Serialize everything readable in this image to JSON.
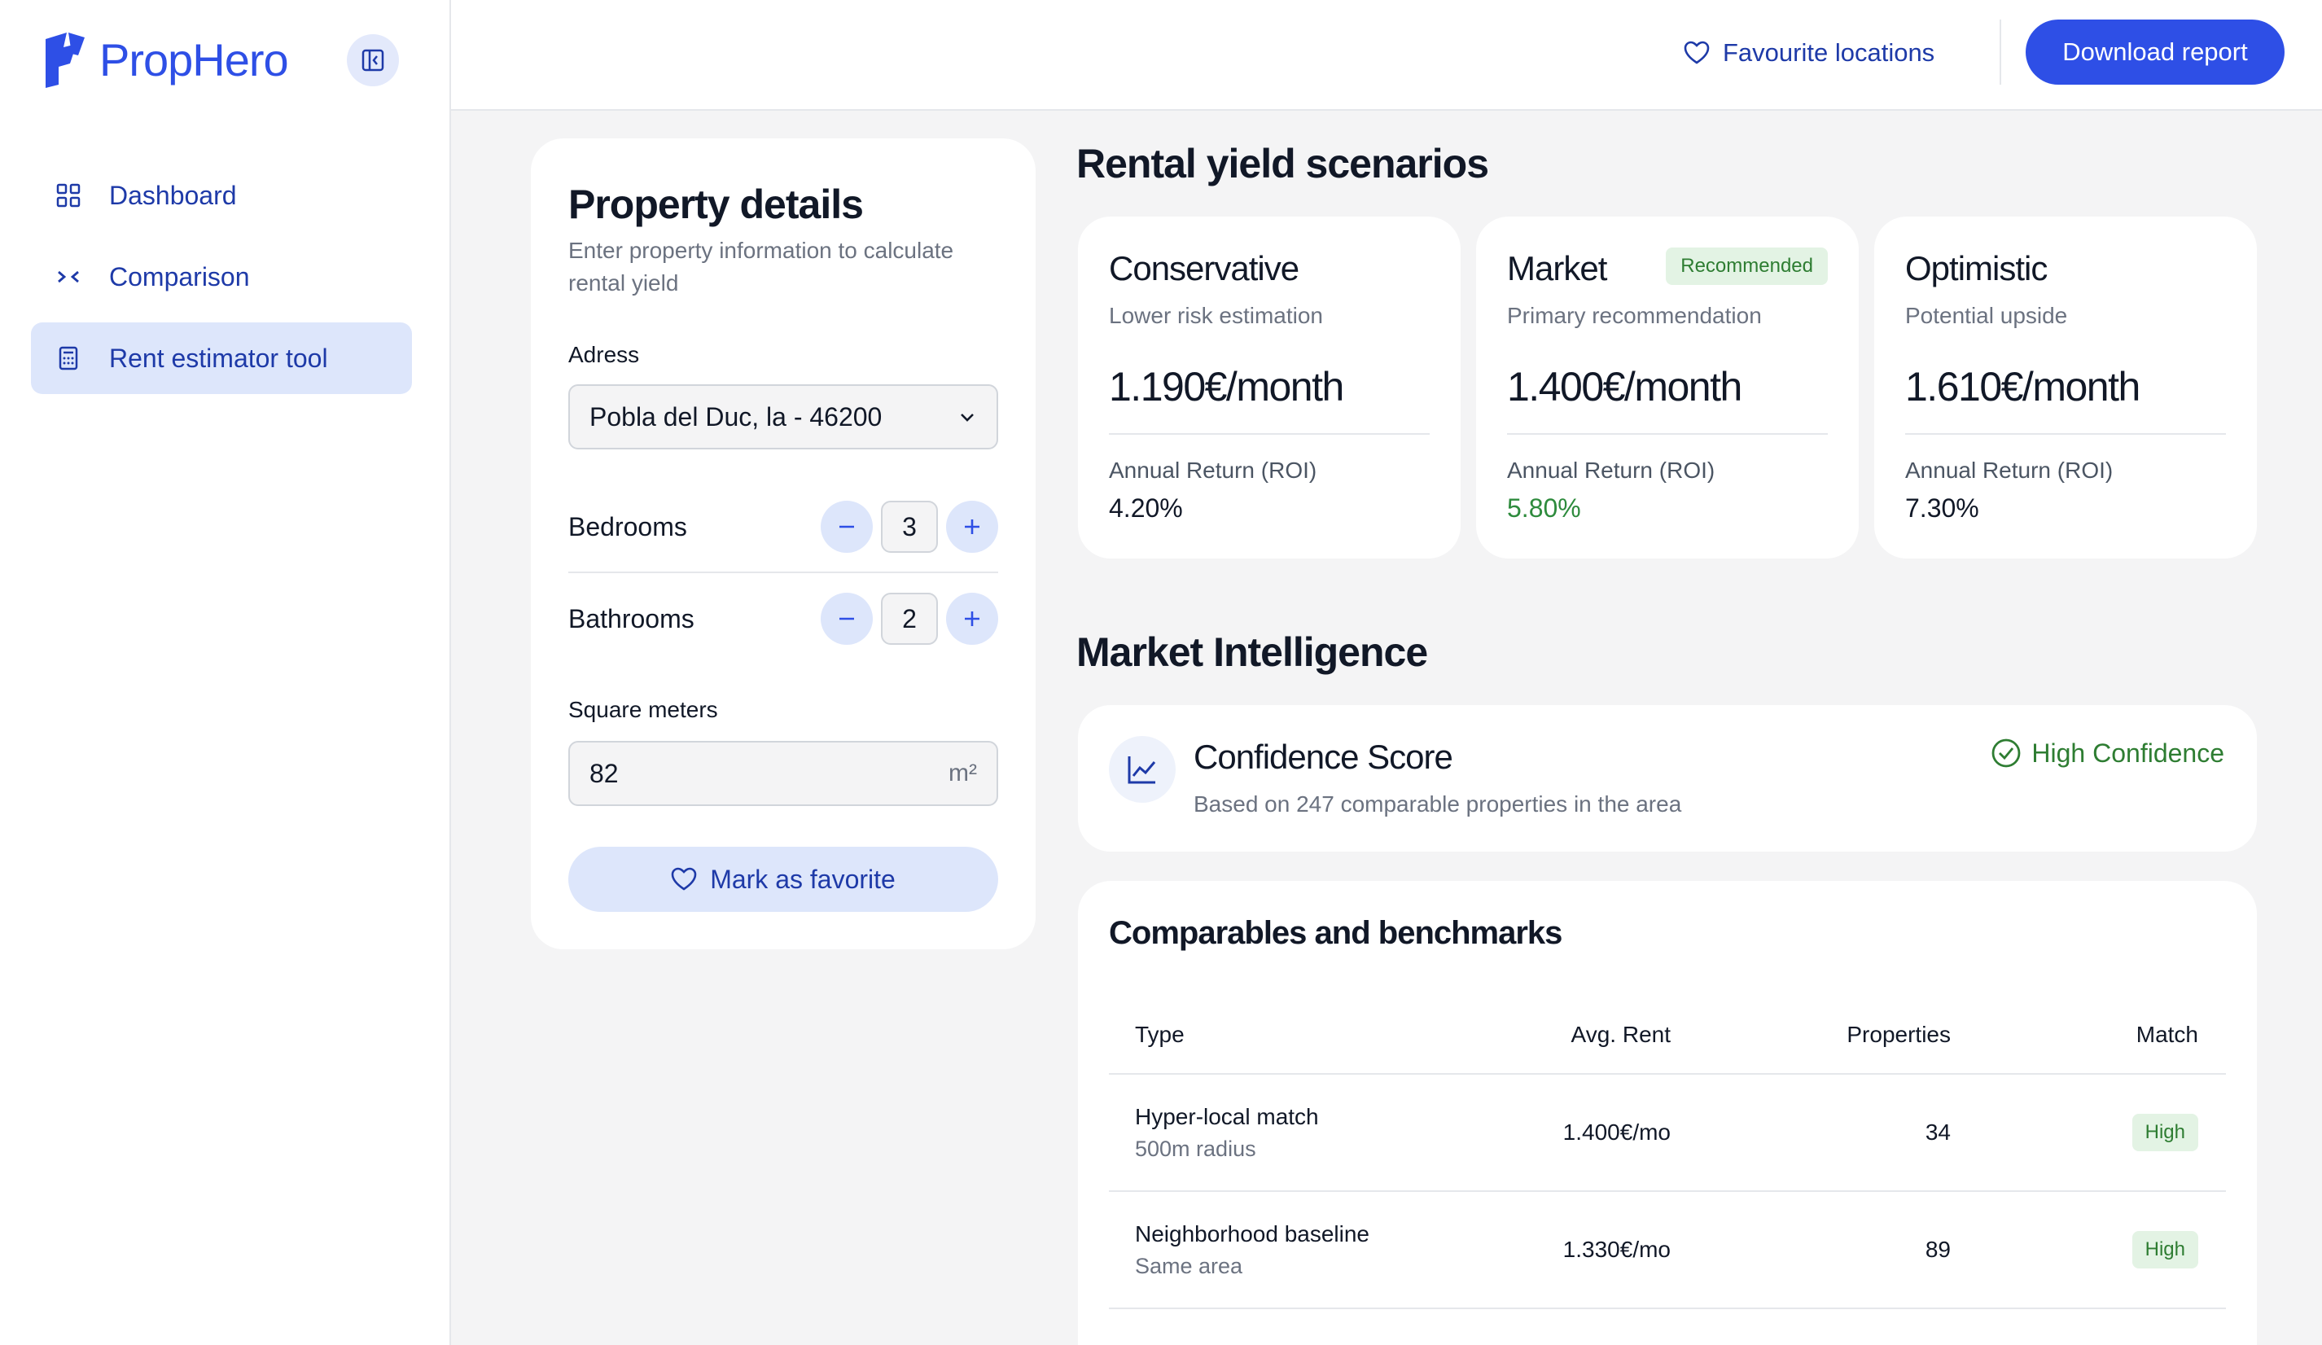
{
  "brand": {
    "name": "PropHero"
  },
  "sidebar": {
    "items": [
      {
        "label": "Dashboard",
        "icon": "grid-icon"
      },
      {
        "label": "Comparison",
        "icon": "compare-icon"
      },
      {
        "label": "Rent estimator tool",
        "icon": "calculator-icon",
        "active": true
      }
    ]
  },
  "topbar": {
    "favourite_label": "Favourite locations",
    "download_label": "Download report"
  },
  "property": {
    "title": "Property details",
    "subtitle": "Enter property information to calculate rental yield",
    "address_label": "Adress",
    "address_value": "Pobla del Duc, la - 46200",
    "bedrooms_label": "Bedrooms",
    "bedrooms_value": "3",
    "bathrooms_label": "Bathrooms",
    "bathrooms_value": "2",
    "sqm_label": "Square meters",
    "sqm_value": "82",
    "sqm_unit": "m²",
    "favorite_label": "Mark as favorite"
  },
  "scenarios": {
    "title": "Rental yield scenarios",
    "items": [
      {
        "name": "Conservative",
        "subtitle": "Lower risk estimation",
        "value": "1.190€/month",
        "roi_label": "Annual Return (ROI)",
        "roi": "4.20%"
      },
      {
        "name": "Market",
        "badge": "Recommended",
        "subtitle": "Primary recommendation",
        "value": "1.400€/month",
        "roi_label": "Annual Return (ROI)",
        "roi": "5.80%"
      },
      {
        "name": "Optimistic",
        "subtitle": "Potential upside",
        "value": "1.610€/month",
        "roi_label": "Annual Return (ROI)",
        "roi": "7.30%"
      }
    ]
  },
  "market": {
    "title": "Market Intelligence",
    "confidence_title": "Confidence Score",
    "confidence_sub": "Based on 247 comparable properties in the area",
    "confidence_status": "High Confidence"
  },
  "comparables": {
    "title": "Comparables and benchmarks",
    "headers": {
      "type": "Type",
      "rent": "Avg. Rent",
      "props": "Properties",
      "match": "Match"
    },
    "rows": [
      {
        "type": "Hyper-local match",
        "sub": "500m radius",
        "rent": "1.400€/mo",
        "props": "34",
        "match": "High"
      },
      {
        "type": "Neighborhood baseline",
        "sub": "Same area",
        "rent": "1.330€/mo",
        "props": "89",
        "match": "High"
      }
    ]
  },
  "colors": {
    "primary": "#2e4fe6",
    "nav_text": "#1e3aa8",
    "success": "#2e7d32"
  }
}
